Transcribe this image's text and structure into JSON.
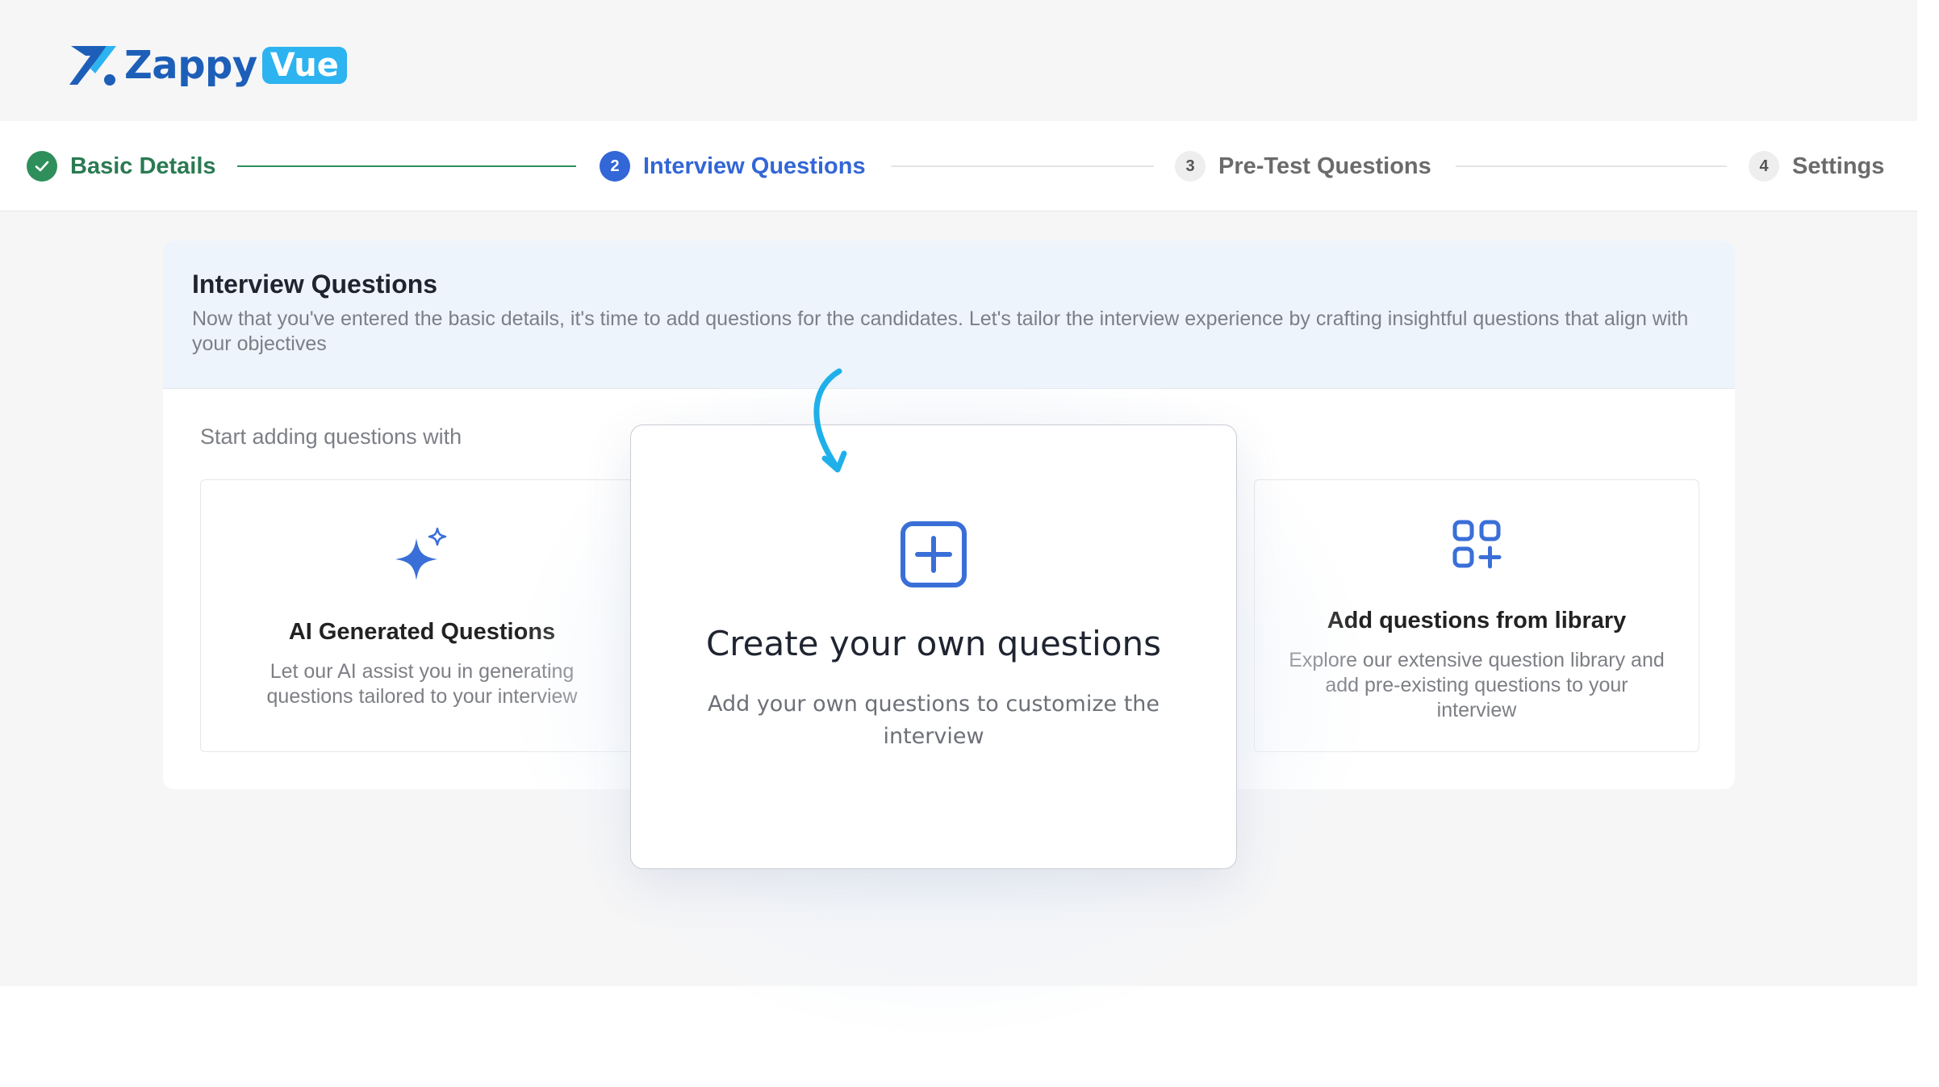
{
  "brand": {
    "name": "Zappy",
    "badge": "Vue",
    "primary_color": "#1d5fb8",
    "accent_color": "#2db3f0"
  },
  "stepper": {
    "steps": [
      {
        "number": "",
        "label": "Basic Details",
        "state": "completed",
        "icon": "check-icon"
      },
      {
        "number": "2",
        "label": "Interview Questions",
        "state": "active"
      },
      {
        "number": "3",
        "label": "Pre-Test Questions",
        "state": "upcoming"
      },
      {
        "number": "4",
        "label": "Settings",
        "state": "upcoming"
      }
    ]
  },
  "section": {
    "title": "Interview Questions",
    "description": "Now that you've entered the basic details, it's time to add questions for the candidates. Let's tailor the interview experience by crafting insightful questions that align with your objectives",
    "start_label": "Start adding questions with"
  },
  "options": [
    {
      "title": "AI Generated Questions",
      "description": "Let our AI assist you in generating questions tailored to your interview",
      "icon": "sparkle-icon"
    },
    {
      "title": "Create your own questions",
      "description": "Add your own questions to customize the interview",
      "icon": "plus-square-icon"
    },
    {
      "title": "Add questions from library",
      "description": "Explore our extensive question library and add pre-existing questions to your interview",
      "icon": "library-grid-icon"
    }
  ],
  "colors": {
    "completed": "#2f8f5b",
    "active": "#3366d6",
    "highlight_arrow": "#1fb0ea"
  }
}
